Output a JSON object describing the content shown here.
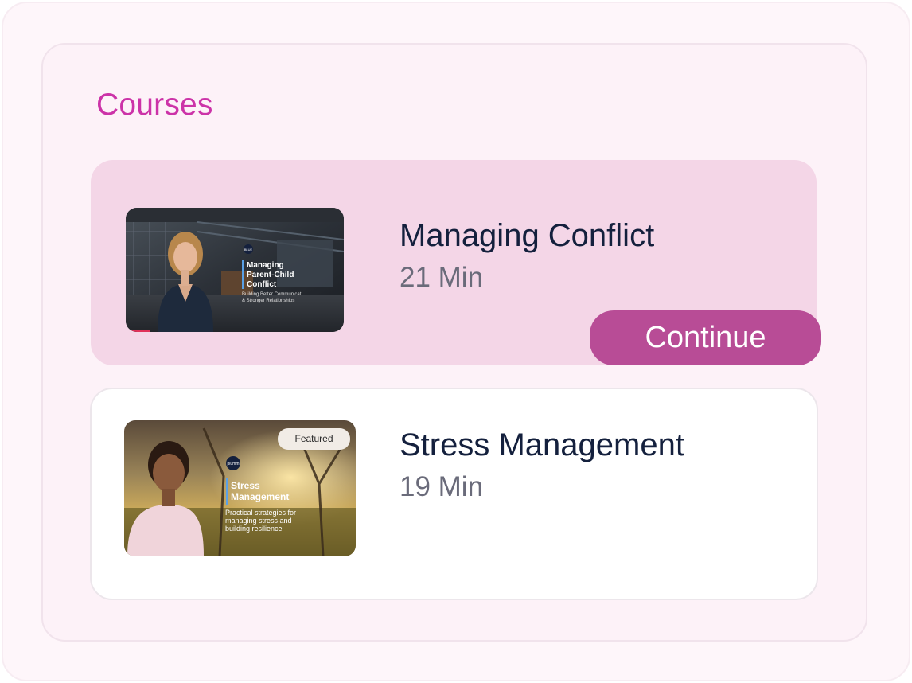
{
  "header": {
    "title": "Courses"
  },
  "courses": [
    {
      "title": "Managing Conflict",
      "duration": "21 Min",
      "action_label": "Continue",
      "thumbnail": {
        "logo": "BLUE",
        "heading_line1": "Managing",
        "heading_line2": "Parent-Child",
        "heading_line3": "Conflict",
        "subtext_line1": "Building Better Communicat",
        "subtext_line2": "& Stronger Relationships"
      }
    },
    {
      "title": "Stress Management",
      "duration": "19 Min",
      "thumbnail": {
        "badge": "Featured",
        "logo": "plumm",
        "heading_line1": "Stress",
        "heading_line2": "Management",
        "subtext_line1": "Practical strategies for",
        "subtext_line2": "managing stress and",
        "subtext_line3": "building resilience"
      }
    }
  ],
  "colors": {
    "accent": "#cc33a8",
    "active_card": "#f4d6e7",
    "button": "#b84c96",
    "title_text": "#14203d",
    "muted_text": "#6a6b7a"
  }
}
